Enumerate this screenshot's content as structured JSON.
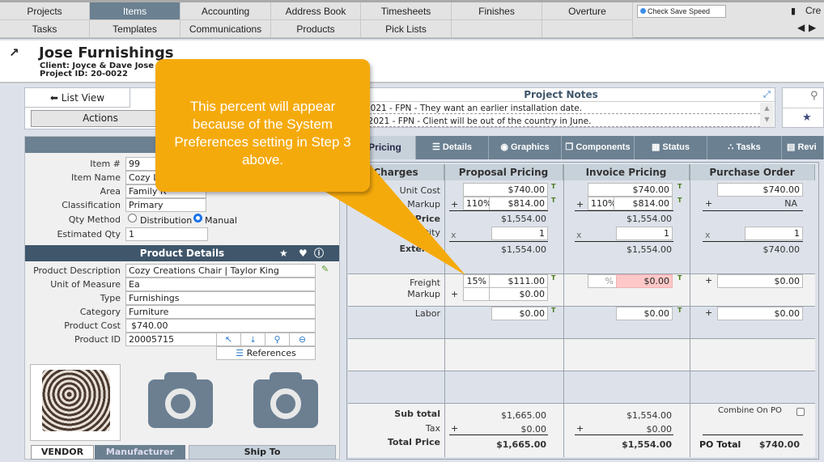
{
  "nav": {
    "row1": [
      "Projects",
      "Items",
      "Accounting",
      "Address Book",
      "Timesheets",
      "Finishes",
      "Overture"
    ],
    "row2": [
      "Tasks",
      "Templates",
      "Communications",
      "Products",
      "Pick Lists"
    ],
    "active": "Items",
    "check_save_speed": "Check Save Speed",
    "create_label": "Cre"
  },
  "header": {
    "title": "Jose Furnishings",
    "client": "Client: Joyce & Dave Jose",
    "project_id": "Project ID: 20-0022"
  },
  "left": {
    "list_view": "List View",
    "actions": "Actions",
    "item_fields": [
      {
        "label": "Item #",
        "value": "99"
      },
      {
        "label": "Item Name",
        "value": "Cozy Lo"
      },
      {
        "label": "Area",
        "value": "Family R"
      },
      {
        "label": "Classification",
        "value": "Primary"
      }
    ],
    "qty_method_label": "Qty Method",
    "qty_options": [
      "Distribution",
      "Manual"
    ],
    "qty_selected": "Manual",
    "estimated_qty_label": "Estimated Qty",
    "estimated_qty": "1",
    "product_details_title": "Product Details",
    "product_fields": [
      {
        "label": "Product Description",
        "value": "Cozy Creations Chair | Taylor King"
      },
      {
        "label": "Unit of Measure",
        "value": "Ea"
      },
      {
        "label": "Type",
        "value": "Furnishings"
      },
      {
        "label": "Category",
        "value": "Furniture"
      },
      {
        "label": "Product Cost",
        "value": "$740.00"
      },
      {
        "label": "Product ID",
        "value": "20005715"
      }
    ],
    "references": "References",
    "bottom_tabs": [
      "VENDOR",
      "Manufacturer",
      "Ship To"
    ]
  },
  "notes": {
    "title": "Project Notes",
    "lines": [
      "2021 - FPN - They want an earlier installation date.",
      "/2021 - FPN - Client will be out of the country in June."
    ]
  },
  "tabs": [
    "Pricing",
    "Details",
    "Graphics",
    "Components",
    "Status",
    "Tasks",
    "Revi"
  ],
  "active_tab": "Pricing",
  "pricing": {
    "headers": [
      "Charges",
      "Proposal Pricing",
      "Invoice Pricing",
      "Purchase Order"
    ],
    "labels": {
      "unit_cost": "Unit Cost",
      "markup": "Markup",
      "unit_price": "nit Price",
      "quantity": "antity",
      "extended": "Extende",
      "freight": "Freight",
      "freight_markup": "Markup",
      "labor": "Labor",
      "subtotal": "Sub total",
      "tax": "Tax",
      "total": "Total Price",
      "combine": "Combine On PO",
      "po_total": "PO Total"
    },
    "proposal": {
      "unit_cost": "$740.00",
      "markup_pct": "110%",
      "markup": "$814.00",
      "unit_price": "$1,554.00",
      "qty": "1",
      "extended": "$1,554.00",
      "freight_pct": "15%",
      "freight": "$111.00",
      "freight_markup": "$0.00",
      "labor": "$0.00",
      "subtotal": "$1,665.00",
      "tax": "$0.00",
      "total": "$1,665.00"
    },
    "invoice": {
      "unit_cost": "$740.00",
      "markup_pct": "110%",
      "markup": "$814.00",
      "unit_price": "$1,554.00",
      "qty": "1",
      "extended": "$1,554.00",
      "freight_pct": "%",
      "freight": "$0.00",
      "labor": "$0.00",
      "subtotal": "$1,554.00",
      "tax": "$0.00",
      "total": "$1,554.00"
    },
    "po": {
      "unit_cost": "$740.00",
      "markup": "NA",
      "qty": "1",
      "extended": "$740.00",
      "freight": "$0.00",
      "labor": "$0.00",
      "po_total": "$740.00"
    }
  },
  "callout": {
    "text": "This percent will appear because of the System Preferences setting in Step 3 above.",
    "color": "#f5aa0c"
  },
  "colors": {
    "nav_active": "#6b8091",
    "panel_header": "#3f566b",
    "invoice_warning": "#ffc8c8"
  }
}
